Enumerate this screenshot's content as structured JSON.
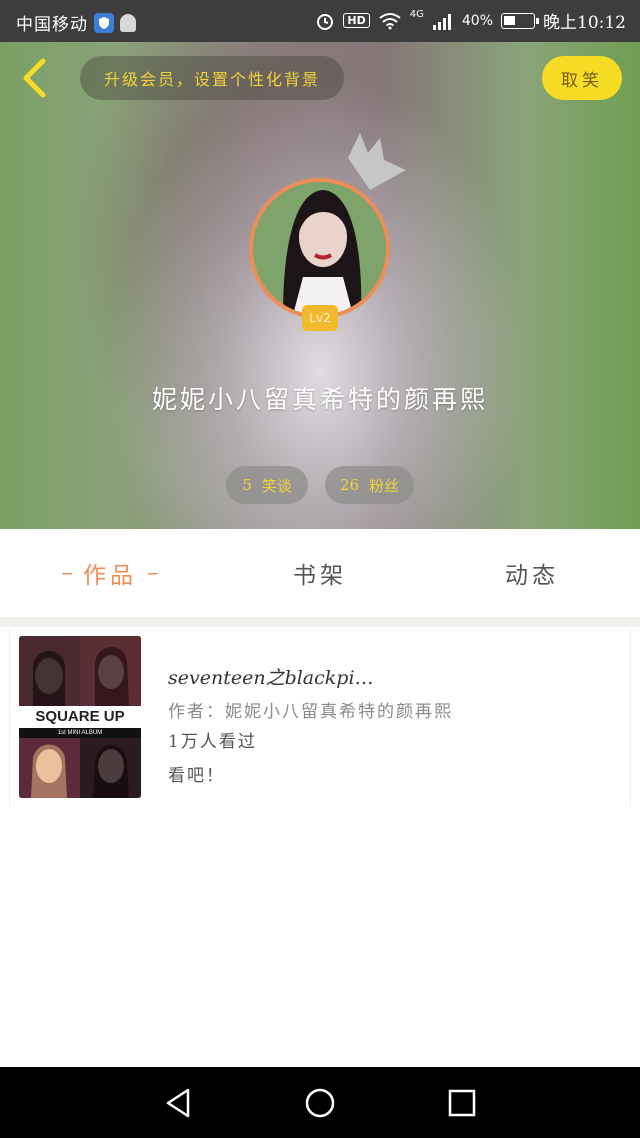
{
  "status_bar": {
    "carrier": "中国移动",
    "network": "4G",
    "battery": "40%",
    "battery_level": 0.4,
    "time": "晚上10:12"
  },
  "header": {
    "hint": "升级会员，设置个性化背景",
    "top_button": "取笑"
  },
  "profile": {
    "level": "Lv2",
    "username": "妮妮小八留真希特的颜再熙",
    "stats": [
      {
        "count": "5",
        "label": "笑谈"
      },
      {
        "count": "26",
        "label": "粉丝"
      }
    ]
  },
  "tabs": [
    {
      "label": "作品",
      "active": true
    },
    {
      "label": "书架",
      "active": false
    },
    {
      "label": "动态",
      "active": false
    }
  ],
  "works": [
    {
      "title": "seventeen之blackpi…",
      "author": "作者：妮妮小八留真希特的颜再熙",
      "views": "1万人看过",
      "desc": "看吧！",
      "cover_title": "SQUARE UP",
      "cover_sub": "1st MINI ALBUM"
    }
  ],
  "colors": {
    "accent": "#ee8d57",
    "yellow": "#f7dc25",
    "pill_text": "#f3d23b"
  },
  "icons": {
    "back": "back-chevron-icon",
    "crown": "crown-icon",
    "nav_back": "triangle-back-icon",
    "nav_home": "circle-home-icon",
    "nav_recent": "square-recents-icon"
  }
}
